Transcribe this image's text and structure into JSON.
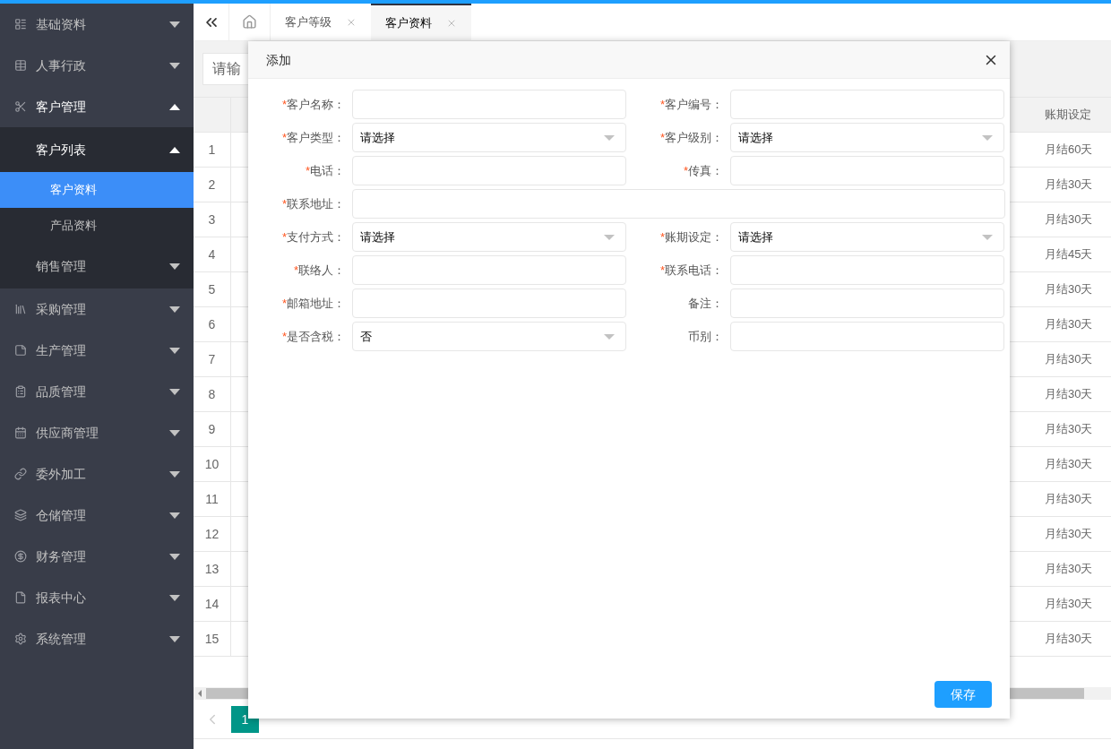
{
  "sidebar": {
    "items": [
      {
        "label": "基础资料",
        "expanded": false
      },
      {
        "label": "人事行政",
        "expanded": false
      },
      {
        "label": "客户管理",
        "expanded": true,
        "children": [
          {
            "label": "客户列表",
            "expanded": true,
            "children": [
              {
                "label": "客户资料",
                "selected": true
              },
              {
                "label": "产品资料",
                "selected": false
              }
            ]
          },
          {
            "label": "销售管理",
            "expanded": false
          }
        ]
      },
      {
        "label": "采购管理",
        "expanded": false
      },
      {
        "label": "生产管理",
        "expanded": false
      },
      {
        "label": "品质管理",
        "expanded": false
      },
      {
        "label": "供应商管理",
        "expanded": false
      },
      {
        "label": "委外加工",
        "expanded": false
      },
      {
        "label": "仓储管理",
        "expanded": false
      },
      {
        "label": "财务管理",
        "expanded": false
      },
      {
        "label": "报表中心",
        "expanded": false
      },
      {
        "label": "系统管理",
        "expanded": false
      }
    ]
  },
  "tabs": [
    {
      "label": "客户等级",
      "selected": false
    },
    {
      "label": "客户资料",
      "selected": true
    }
  ],
  "search": {
    "placeholder": "请输"
  },
  "table": {
    "columns": [
      "账期设定"
    ],
    "rows": [
      {
        "index": "1",
        "term": "月结60天"
      },
      {
        "index": "2",
        "term": "月结30天"
      },
      {
        "index": "3",
        "term": "月结30天"
      },
      {
        "index": "4",
        "term": "月结45天"
      },
      {
        "index": "5",
        "term": "月结30天"
      },
      {
        "index": "6",
        "term": "月结30天"
      },
      {
        "index": "7",
        "term": "月结30天"
      },
      {
        "index": "8",
        "term": "月结30天"
      },
      {
        "index": "9",
        "term": "月结30天"
      },
      {
        "index": "10",
        "term": "月结30天"
      },
      {
        "index": "11",
        "term": "月结30天"
      },
      {
        "index": "12",
        "term": "月结30天"
      },
      {
        "index": "13",
        "term": "月结30天"
      },
      {
        "index": "14",
        "term": "月结30天"
      },
      {
        "index": "15",
        "term": "月结30天"
      }
    ]
  },
  "pagination": {
    "pages": [
      {
        "label": "1",
        "selected": true
      }
    ]
  },
  "dialog": {
    "title": "添加",
    "rows": [
      {
        "fields": [
          {
            "label": "客户名称：",
            "required_mark": "*",
            "kind": "text"
          },
          {
            "label": "客户编号：",
            "required_mark": "*",
            "kind": "text"
          }
        ]
      },
      {
        "fields": [
          {
            "label": "客户类型：",
            "required_mark": "*",
            "kind": "select",
            "value": "请选择"
          },
          {
            "label": "客户级别：",
            "required_mark": "*",
            "kind": "select",
            "value": "请选择"
          }
        ]
      },
      {
        "fields": [
          {
            "label": "电话：",
            "required_mark": "*",
            "kind": "text"
          },
          {
            "label": "传真：",
            "required_mark": "*",
            "kind": "text"
          }
        ]
      },
      {
        "fields": [
          {
            "label": "联系地址：",
            "required_mark": "*",
            "kind": "text"
          }
        ]
      },
      {
        "fields": [
          {
            "label": "支付方式：",
            "required_mark": "*",
            "kind": "select",
            "value": "请选择"
          },
          {
            "label": "账期设定：",
            "required_mark": "*",
            "kind": "select",
            "value": "请选择"
          }
        ]
      },
      {
        "fields": [
          {
            "label": "联络人：",
            "required_mark": "*",
            "kind": "text"
          },
          {
            "label": "联系电话：",
            "required_mark": "*",
            "kind": "text"
          }
        ]
      },
      {
        "fields": [
          {
            "label": "邮箱地址：",
            "required_mark": "*",
            "kind": "text"
          },
          {
            "label": "备注：",
            "kind": "text"
          }
        ]
      },
      {
        "fields": [
          {
            "label": "是否含税：",
            "required_mark": "*",
            "kind": "select",
            "value": "否"
          },
          {
            "label": "币别：",
            "kind": "text"
          }
        ]
      }
    ],
    "save_button": "保存"
  }
}
